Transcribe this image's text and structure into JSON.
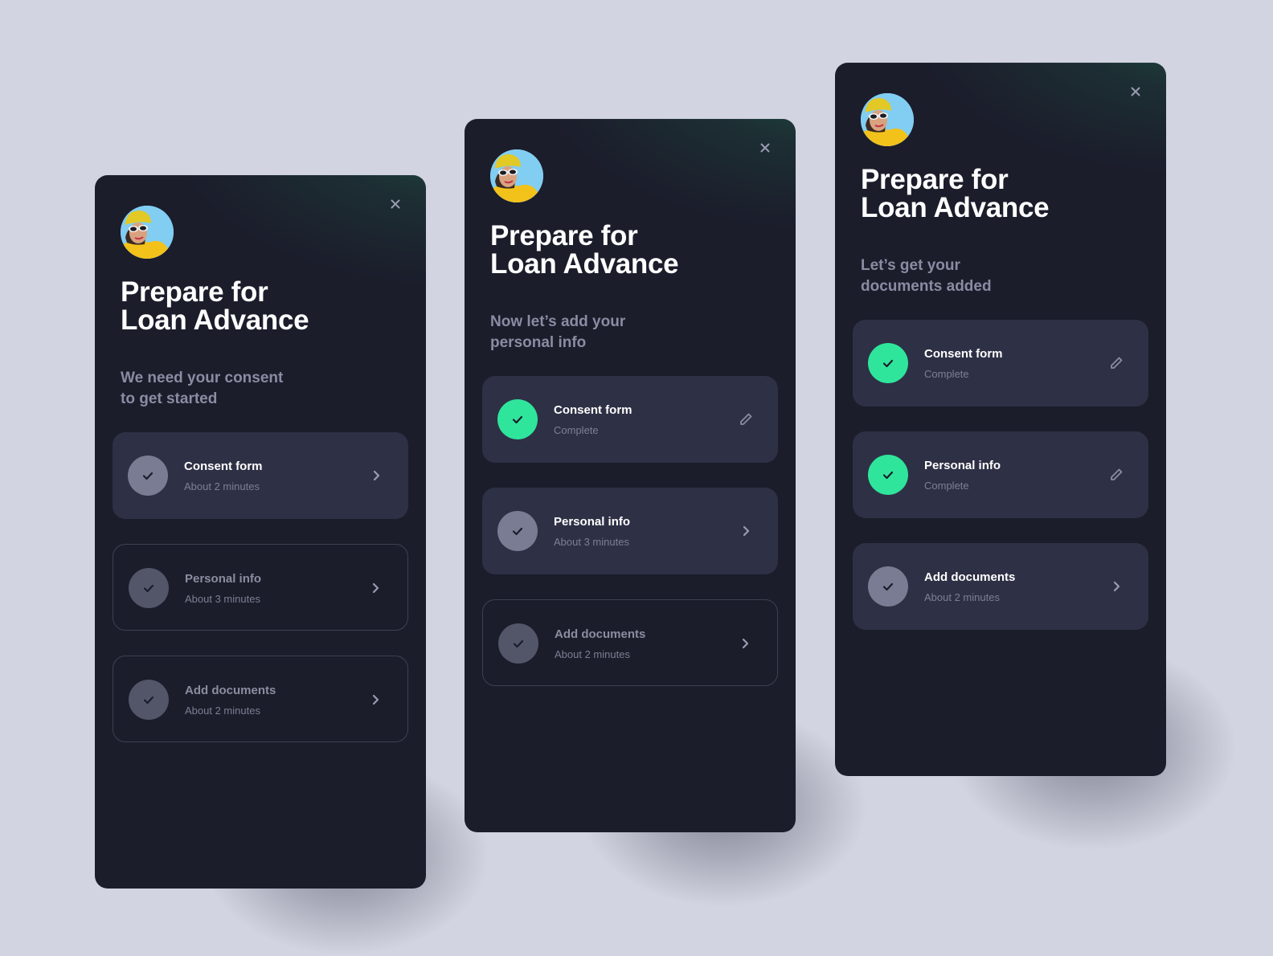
{
  "background_color": "#d2d4e1",
  "accent_color": "#2fe59c",
  "screens": [
    {
      "title_lines": [
        "Prepare for",
        "Loan Advance"
      ],
      "subtitle_lines": [
        "We need your consent",
        "to get started"
      ],
      "close_icon": "close-icon",
      "steps": [
        {
          "title": "Consent form",
          "subtitle": "About 2 minutes",
          "state": "active",
          "action_icon": "chevron-right-icon"
        },
        {
          "title": "Personal info",
          "subtitle": "About 3 minutes",
          "state": "pending",
          "action_icon": "chevron-right-icon"
        },
        {
          "title": "Add documents",
          "subtitle": "About 2 minutes",
          "state": "pending",
          "action_icon": "chevron-right-icon"
        }
      ]
    },
    {
      "title_lines": [
        "Prepare for",
        "Loan Advance"
      ],
      "subtitle_lines": [
        "Now let’s add your",
        "personal info"
      ],
      "close_icon": "close-icon",
      "steps": [
        {
          "title": "Consent form",
          "subtitle": "Complete",
          "state": "done",
          "action_icon": "pencil-icon"
        },
        {
          "title": "Personal info",
          "subtitle": "About 3 minutes",
          "state": "active",
          "action_icon": "chevron-right-icon"
        },
        {
          "title": "Add documents",
          "subtitle": "About 2 minutes",
          "state": "pending",
          "action_icon": "chevron-right-icon"
        }
      ]
    },
    {
      "title_lines": [
        "Prepare for",
        "Loan Advance"
      ],
      "subtitle_lines": [
        "Let’s get your",
        "documents added"
      ],
      "close_icon": "close-icon",
      "steps": [
        {
          "title": "Consent form",
          "subtitle": "Complete",
          "state": "done",
          "action_icon": "pencil-icon"
        },
        {
          "title": "Personal info",
          "subtitle": "Complete",
          "state": "done",
          "action_icon": "pencil-icon"
        },
        {
          "title": "Add documents",
          "subtitle": "About 2 minutes",
          "state": "active",
          "action_icon": "chevron-right-icon"
        }
      ]
    }
  ]
}
